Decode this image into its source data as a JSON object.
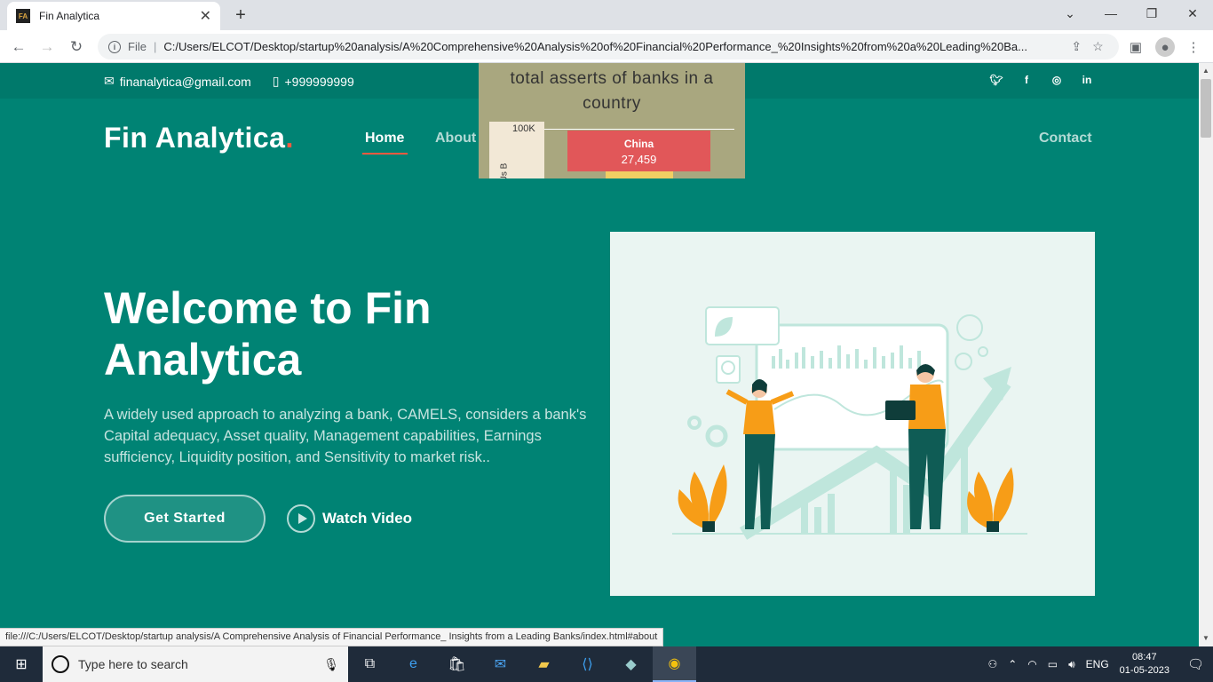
{
  "browser": {
    "tab_title": "Fin Analytica",
    "favicon": "FA",
    "new_tab": "+",
    "file_label": "File",
    "url": "C:/Users/ELCOT/Desktop/startup%20analysis/A%20Comprehensive%20Analysis%20of%20Financial%20Performance_%20Insights%20from%20a%20Leading%20Ba...",
    "status_url": "file:///C:/Users/ELCOT/Desktop/startup analysis/A Comprehensive Analysis of Financial Performance_ Insights from a Leading Banks/index.html#about"
  },
  "topbar": {
    "email": "finanalytica@gmail.com",
    "phone": "+999999999",
    "socials": [
      "twitter-icon",
      "facebook-icon",
      "instagram-icon",
      "linkedin-icon"
    ]
  },
  "header": {
    "logo": "Fin Analytica",
    "logo_dot": ".",
    "nav": {
      "home": "Home",
      "about": "About",
      "contact": "Contact"
    }
  },
  "chart_popup": {
    "title_line1": "total asserts of banks in a",
    "title_line2": "country"
  },
  "chart_data": {
    "type": "bar",
    "title": "total asserts of banks in a country",
    "ylabel": "Us B",
    "yticks": [
      "100K"
    ],
    "categories": [
      "China"
    ],
    "values": [
      27459
    ],
    "value_labels": [
      "27,459"
    ],
    "colors": [
      "#e15759",
      "#f1ce63"
    ]
  },
  "hero": {
    "title": "Welcome to Fin Analytica",
    "description": "A widely used approach to analyzing a bank, CAMELS, considers a bank's Capital adequacy, Asset quality, Management capabilities, Earnings sufficiency, Liquidity position, and Sensitivity to market risk..",
    "cta": "Get Started",
    "video": "Watch Video"
  },
  "taskbar": {
    "search_placeholder": "Type here to search",
    "lang": "ENG",
    "time": "08:47",
    "date": "01-05-2023"
  },
  "colors": {
    "primary": "#008374",
    "topbar": "#00796b",
    "accent": "#f85a40",
    "illustration_orange": "#f79d17"
  }
}
